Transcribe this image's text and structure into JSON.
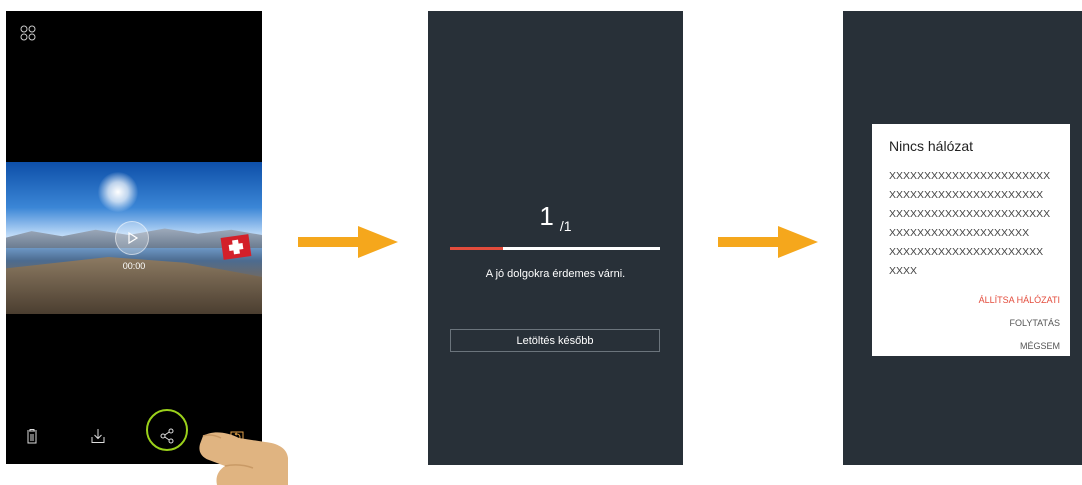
{
  "screen1": {
    "video_time": "00:00",
    "toolbar": {
      "delete_icon": "trash-icon",
      "download_icon": "download-icon",
      "share_icon": "share-icon",
      "reset_icon": "rotate-icon"
    },
    "highlight_color": "#9bd11b"
  },
  "screen2": {
    "counter_current": "1",
    "counter_total": "/1",
    "progress": 0.25,
    "tagline": "A jó dolgokra érdemes várni.",
    "later_button": "Letöltés később"
  },
  "screen3": {
    "dialog_title": "Nincs hálózat",
    "dialog_lines": [
      "XXXXXXXXXXXXXXXXXXXXXXX",
      "XXXXXXXXXXXXXXXXXXXXXX",
      "XXXXXXXXXXXXXXXXXXXXXXX",
      "XXXXXXXXXXXXXXXXXXXX",
      "XXXXXXXXXXXXXXXXXXXXXX",
      "XXXX"
    ],
    "action_settings": "ÁLLÍTSA HÁLÓZATI",
    "action_continue": "FOLYTATÁS",
    "action_cancel": "MÉGSEM"
  },
  "colors": {
    "arrow": "#f5a71c",
    "dark_bg": "#283038",
    "accent_red": "#e34c3c"
  }
}
